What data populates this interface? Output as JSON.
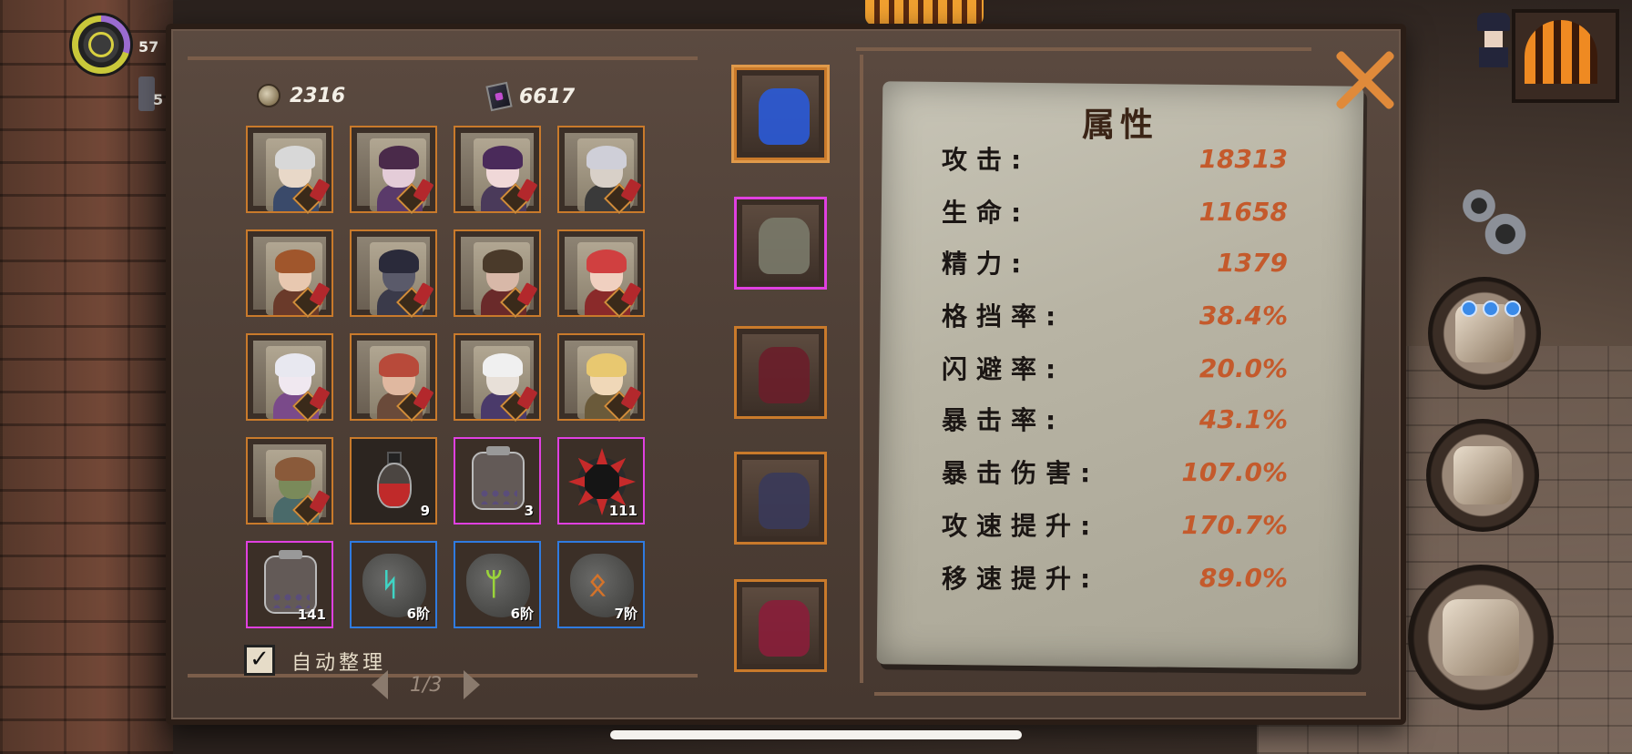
{
  "hud": {
    "top_number": "57",
    "second_number": "5"
  },
  "currency": {
    "coins": "2316",
    "books": "6617"
  },
  "inventory": {
    "slots": [
      {
        "kind": "hero",
        "skin": "#e8d8c8",
        "hair": "#d8d8d8",
        "outfit": "#3a4a6a"
      },
      {
        "kind": "hero",
        "skin": "#e4ccd8",
        "hair": "#4a2a4a",
        "outfit": "#5a3a6a"
      },
      {
        "kind": "hero",
        "skin": "#f0d8d8",
        "hair": "#4a2a5a",
        "outfit": "#4a3a5a"
      },
      {
        "kind": "hero",
        "skin": "#d8d0c8",
        "hair": "#cfcfd8",
        "outfit": "#3a3a3a"
      },
      {
        "kind": "hero",
        "skin": "#e8c8b0",
        "hair": "#a0562c",
        "outfit": "#6a3a2a"
      },
      {
        "kind": "hero",
        "skin": "#5a5a6a",
        "hair": "#2a2a3a",
        "outfit": "#3a3a4a"
      },
      {
        "kind": "hero",
        "skin": "#d8b8a8",
        "hair": "#4a3a2a",
        "outfit": "#6a2a2a"
      },
      {
        "kind": "hero",
        "skin": "#f0d0c0",
        "hair": "#d04040",
        "outfit": "#8a2a2a"
      },
      {
        "kind": "hero",
        "skin": "#f0e8f0",
        "hair": "#e8e8f0",
        "outfit": "#7a4a8a"
      },
      {
        "kind": "hero",
        "skin": "#e0b8a0",
        "hair": "#b84a3a",
        "outfit": "#6a4a3a"
      },
      {
        "kind": "hero",
        "skin": "#e8e0d8",
        "hair": "#f0f0f0",
        "outfit": "#4a3a6a"
      },
      {
        "kind": "hero",
        "skin": "#f0d8b8",
        "hair": "#e8c870",
        "outfit": "#6a5a3a"
      },
      {
        "kind": "hero",
        "skin": "#7a8a5a",
        "hair": "#8a5a3a",
        "outfit": "#4a6a6a"
      },
      {
        "kind": "potion",
        "fill": "#c02a2a",
        "count": "9",
        "frame": "dark"
      },
      {
        "kind": "jar",
        "count": "3",
        "frame": "purple"
      },
      {
        "kind": "cog",
        "count": "111",
        "frame": "purple"
      },
      {
        "kind": "jar",
        "count": "141",
        "frame": "purple"
      },
      {
        "kind": "rune",
        "glyph": "ᛋ",
        "color": "#3fd4c4",
        "count": "6阶",
        "frame": "blue"
      },
      {
        "kind": "rune",
        "glyph": "ᛘ",
        "color": "#9ad43a",
        "count": "6阶",
        "frame": "blue"
      },
      {
        "kind": "rune",
        "glyph": "ᛟ",
        "color": "#d4732a",
        "count": "7阶",
        "frame": "blue"
      }
    ],
    "auto_sort_label": "自动整理",
    "auto_sort_checked": "✓",
    "page": "1/3"
  },
  "equipment": [
    {
      "name": "weapon",
      "color": "#2a5ad8",
      "frame": "orange",
      "selected": true
    },
    {
      "name": "offhand",
      "color": "#7a7a6a",
      "frame": "purple",
      "selected": false
    },
    {
      "name": "hood",
      "color": "#6a1e2a",
      "frame": "orange",
      "selected": false
    },
    {
      "name": "jacket",
      "color": "#3a3a5a",
      "frame": "orange",
      "selected": false
    },
    {
      "name": "boots",
      "color": "#8a1e3a",
      "frame": "orange",
      "selected": false
    }
  ],
  "attributes": {
    "title": "属性",
    "rows": [
      {
        "label": "攻击:",
        "value": "18313"
      },
      {
        "label": "生命:",
        "value": "11658"
      },
      {
        "label": "精力:",
        "value": "1379"
      },
      {
        "label": "格挡率:",
        "value": "38.4%"
      },
      {
        "label": "闪避率:",
        "value": "20.0%"
      },
      {
        "label": "暴击率:",
        "value": "43.1%"
      },
      {
        "label": "暴击伤害:",
        "value": "107.0%"
      },
      {
        "label": "攻速提升:",
        "value": "170.7%"
      },
      {
        "label": "移速提升:",
        "value": "89.0%"
      }
    ]
  },
  "icons": {
    "close": "close-x-icon",
    "settings": "gear-icon"
  },
  "colors": {
    "orange_frame": "#c97a2b",
    "purple_frame": "#e040e0",
    "blue_frame": "#2f7be0",
    "attr_value": "#c45a2c"
  }
}
